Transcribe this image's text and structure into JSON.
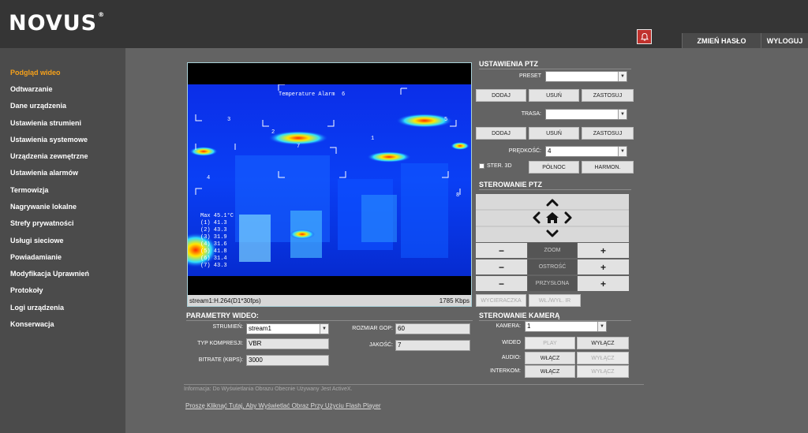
{
  "header": {
    "logo": "NOVUS",
    "logo_mark": "®",
    "change_password": "ZMIEŃ HASŁO",
    "logout": "WYLOGUJ",
    "alarm_icon": "bell-icon"
  },
  "sidebar": {
    "items": [
      {
        "label": "Podgląd wideo"
      },
      {
        "label": "Odtwarzanie"
      },
      {
        "label": "Dane urządzenia"
      },
      {
        "label": "Ustawienia strumieni"
      },
      {
        "label": "Ustawienia systemowe"
      },
      {
        "label": "Urządzenia zewnętrzne"
      },
      {
        "label": "Ustawienia alarmów"
      },
      {
        "label": "Termowizja"
      },
      {
        "label": "Nagrywanie lokalne"
      },
      {
        "label": "Strefy prywatności"
      },
      {
        "label": "Usługi sieciowe"
      },
      {
        "label": "Powiadamianie"
      },
      {
        "label": "Modyfikacja Uprawnień"
      },
      {
        "label": "Protokoły"
      },
      {
        "label": "Logi urządzenia"
      },
      {
        "label": "Konserwacja"
      }
    ],
    "active_color": "#f6a11a"
  },
  "video": {
    "overlay_title": "Temperature Alarm",
    "overlay_num": "6",
    "readings": [
      "Max 45.1°C",
      "(1) 41.3",
      "(2) 43.3",
      "(3) 31.9",
      "(4) 31.6",
      "(5) 41.8",
      "(6) 31.4",
      "(7) 43.3"
    ],
    "zones": [
      "1",
      "2",
      "3",
      "4",
      "5",
      "7",
      "8"
    ],
    "stream_info": "stream1:H.264(D1*30fps)",
    "bitrate": "1785 Kbps"
  },
  "ptz": {
    "title": "USTAWIENIA PTZ",
    "preset_label": "PRESET",
    "preset_value": "",
    "route_label": "TRASA:",
    "route_value": "",
    "speed_label": "PRĘDKOŚĆ:",
    "speed_value": "4",
    "add": "DODAJ",
    "remove": "USUŃ",
    "apply": "ZASTOSUJ",
    "ster3d": "STER. 3D",
    "north": "PÓŁNOC",
    "harmon": "HARMON."
  },
  "ptz_control": {
    "title": "STEROWANIE PTZ",
    "zoom": "ZOOM",
    "focus": "OSTROŚĆ",
    "iris": "PRZYSŁONA",
    "minus": "−",
    "plus": "+",
    "wiper": "WYCIERACZKA",
    "ir": "WŁ./WYŁ. IR"
  },
  "video_params": {
    "title": "PARAMETRY WIDEO:",
    "stream_label": "STRUMIEŃ:",
    "stream_value": "stream1",
    "compression_label": "TYP KOMPRESJI:",
    "compression_value": "VBR",
    "bitrate_label": "BITRATE (KBPS):",
    "bitrate_value": "3000",
    "gop_label": "ROZMIAR GOP:",
    "gop_value": "60",
    "quality_label": "JAKOŚĆ:",
    "quality_value": "7"
  },
  "camera_control": {
    "title": "STEROWANIE KAMERĄ",
    "camera_label": "KAMERA:",
    "camera_value": "1",
    "video_label": "WIDEO",
    "audio_label": "AUDIO:",
    "intercom_label": "INTERKOM:",
    "play": "PLAY",
    "on": "WŁĄCZ",
    "off": "WYŁĄCZ"
  },
  "footer": {
    "info": "Informacja: Do Wyświetlania Obrazu Obecnie Używany Jest ActiveX.",
    "flash_link": "Proszę Kliknąć Tutaj, Aby Wyświetlać Obraz Przy Użyciu Flash Player"
  }
}
